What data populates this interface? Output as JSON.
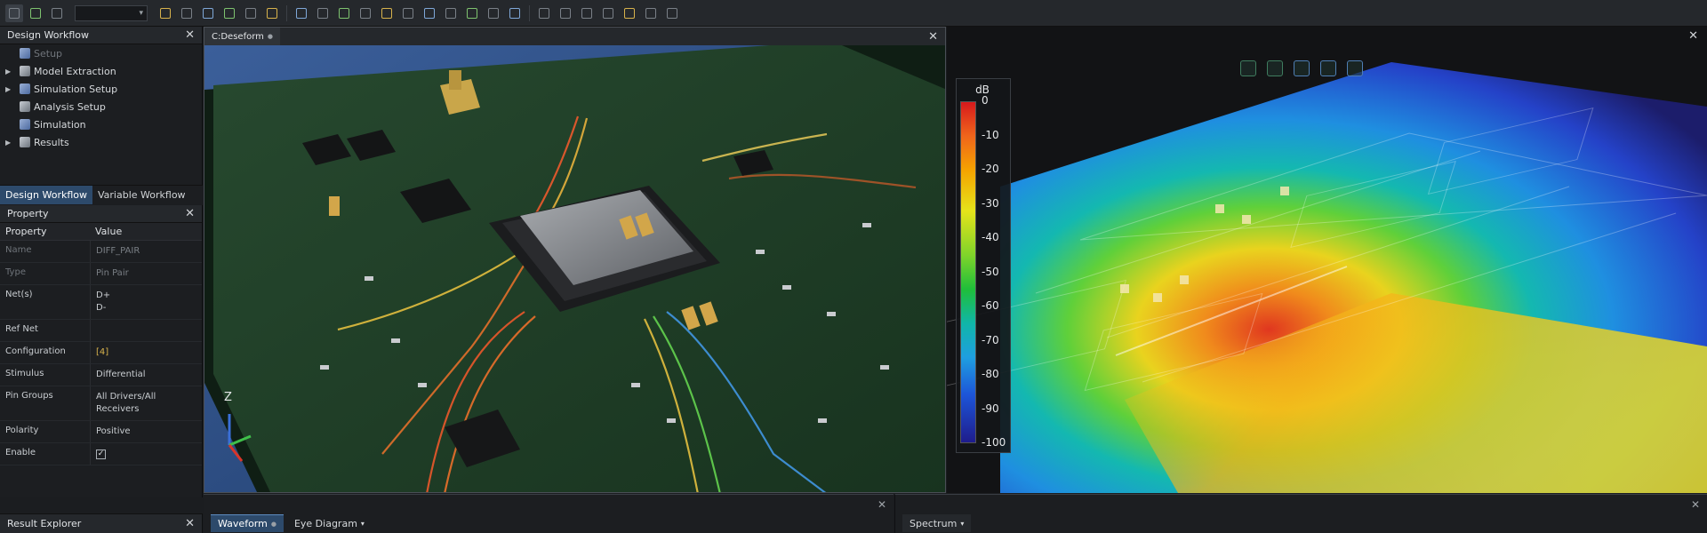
{
  "toolbar": {
    "dropdown_value": "",
    "icons": [
      "open-icon",
      "save-icon",
      "layers-icon",
      "component-icon",
      "refresh-icon",
      "grid-icon",
      "probe-icon",
      "net-icon",
      "route-icon",
      "fit-icon",
      "zoom-in-icon",
      "zoom-out-icon",
      "rotate-icon",
      "measure-icon",
      "highlight-icon",
      "mesh-icon",
      "port-icon",
      "via-icon",
      "select-icon",
      "pan-icon",
      "window-icon",
      "view-top-icon",
      "view-front-icon",
      "view-side-icon",
      "camera-icon",
      "export-icon",
      "settings-icon"
    ]
  },
  "design_workflow": {
    "title": "Design Workflow",
    "items": [
      {
        "label": "Setup",
        "dim": true
      },
      {
        "label": "Model Extraction"
      },
      {
        "label": "Simulation Setup"
      },
      {
        "label": "Analysis Setup"
      },
      {
        "label": "Simulation"
      },
      {
        "label": "Results"
      }
    ],
    "tabs": [
      "Design Workflow",
      "Variable Workflow"
    ]
  },
  "property_panel": {
    "title": "Property",
    "col_property": "Property",
    "col_value": "Value",
    "rows": [
      {
        "name": "Name",
        "value": "DIFF_PAIR"
      },
      {
        "name": "Type",
        "value": "Pin Pair"
      },
      {
        "name": "Net(s)",
        "value": "D+",
        "value2": "D-"
      },
      {
        "name": "Ref Net",
        "value": ""
      },
      {
        "name": "Configuration",
        "value": "[4]"
      },
      {
        "name": "Stimulus",
        "value": "Differential"
      },
      {
        "name": "Pin Groups",
        "value": "All Drivers/All Receivers"
      },
      {
        "name": "Polarity",
        "value": "Positive"
      },
      {
        "name": "Enable",
        "value": "✓"
      }
    ]
  },
  "result_explorer": {
    "title": "Result Explorer"
  },
  "viewport_left": {
    "tab": "C:Deseform",
    "axis_label": "Z"
  },
  "viewport_right": {
    "legend_unit": "dB",
    "legend_ticks": [
      "0",
      "-10",
      "-20",
      "-30",
      "-40",
      "-50",
      "-60",
      "-70",
      "-80",
      "-90",
      "-100"
    ]
  },
  "bottom_left": {
    "tabs": [
      "Waveform",
      "Eye Diagram"
    ]
  },
  "bottom_right": {
    "tabs": [
      "Spectrum"
    ]
  },
  "close_glyph": "✕"
}
